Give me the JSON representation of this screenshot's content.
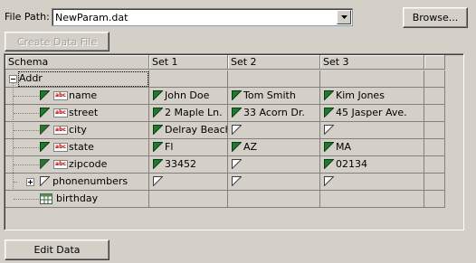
{
  "file_path": {
    "label": "File Path:",
    "value": "NewParam.dat"
  },
  "buttons": {
    "browse": "Browse...",
    "create_data_file": "Create Data File",
    "edit_data": "Edit Data"
  },
  "grid": {
    "headers": [
      "Schema",
      "Set 1",
      "Set 2",
      "Set 3"
    ],
    "root": "Addr",
    "rows": [
      {
        "name": "name",
        "icon": "abc-string-icon",
        "set1": "John Doe",
        "set2": "Tom Smith",
        "set3": "Kim Jones",
        "f1": true,
        "f2": true,
        "f3": true
      },
      {
        "name": "street",
        "icon": "abc-string-icon",
        "set1": "2 Maple Ln.",
        "set2": "33 Acorn Dr.",
        "set3": "45 Jasper Ave.",
        "f1": true,
        "f2": true,
        "f3": true
      },
      {
        "name": "city",
        "icon": "abc-string-icon",
        "set1": "Delray Beach",
        "set2": "",
        "set3": "",
        "f1": true,
        "f2": false,
        "f3": false
      },
      {
        "name": "state",
        "icon": "abc-string-icon",
        "set1": "Fl",
        "set2": "AZ",
        "set3": "MA",
        "f1": true,
        "f2": true,
        "f3": true
      },
      {
        "name": "zipcode",
        "icon": "abc-string-icon",
        "set1": "33452",
        "set2": "",
        "set3": "02134",
        "f1": true,
        "f2": false,
        "f3": true
      },
      {
        "name": "phonenumbers",
        "icon": "",
        "set1": "",
        "set2": "",
        "set3": "",
        "f1": false,
        "f2": false,
        "f3": false
      },
      {
        "name": "birthday",
        "icon": "table-icon",
        "set1": "",
        "set2": "",
        "set3": "",
        "f1": null,
        "f2": null,
        "f3": null
      }
    ]
  },
  "colors": {
    "flag_filled": "#1f7a2e",
    "background": "#d4d0c8"
  }
}
